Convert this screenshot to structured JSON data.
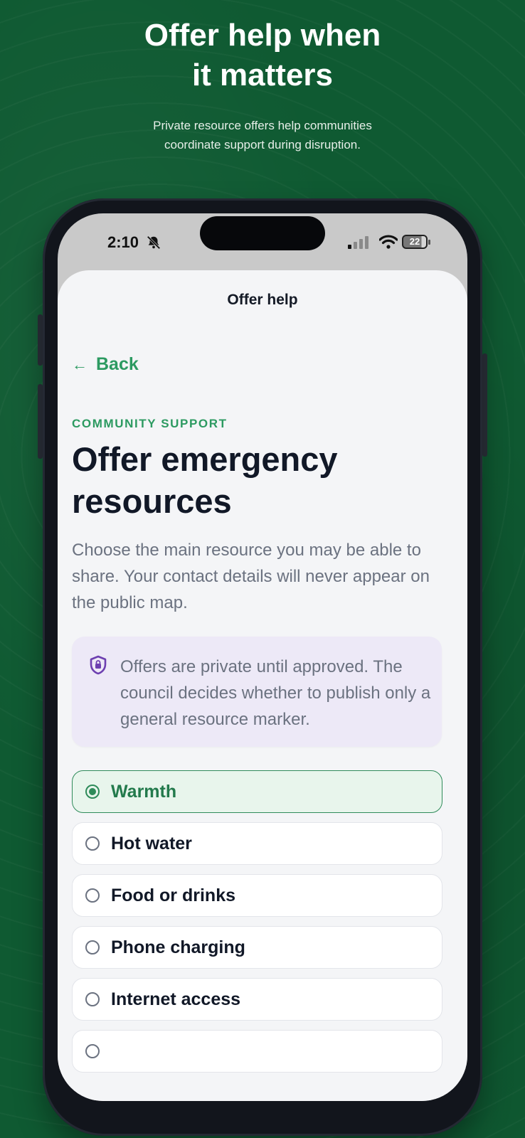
{
  "promo": {
    "headline_line1": "Offer help when",
    "headline_line2": "it matters",
    "subhead_line1": "Private resource offers help communities",
    "subhead_line2": "coordinate support during disruption."
  },
  "status_bar": {
    "time": "2:10",
    "battery": "22"
  },
  "sheet": {
    "title": "Offer help",
    "back_label": "Back",
    "eyebrow": "COMMUNITY SUPPORT",
    "heading": "Offer emergency resources",
    "description": "Choose the main resource you may be able to share. Your contact details will never appear on the public map.",
    "notice": "Offers are private until approved. The council decides whether to publish only a general resource marker."
  },
  "options": [
    {
      "label": "Warmth",
      "selected": true
    },
    {
      "label": "Hot water",
      "selected": false
    },
    {
      "label": "Food or drinks",
      "selected": false
    },
    {
      "label": "Phone charging",
      "selected": false
    },
    {
      "label": "Internet access",
      "selected": false
    }
  ],
  "colors": {
    "background": "#0f5a32",
    "accent": "#2c9a61",
    "selected_bg": "#e8f5ec",
    "notice_bg": "#ede9f7",
    "shield": "#6d3fb0"
  }
}
